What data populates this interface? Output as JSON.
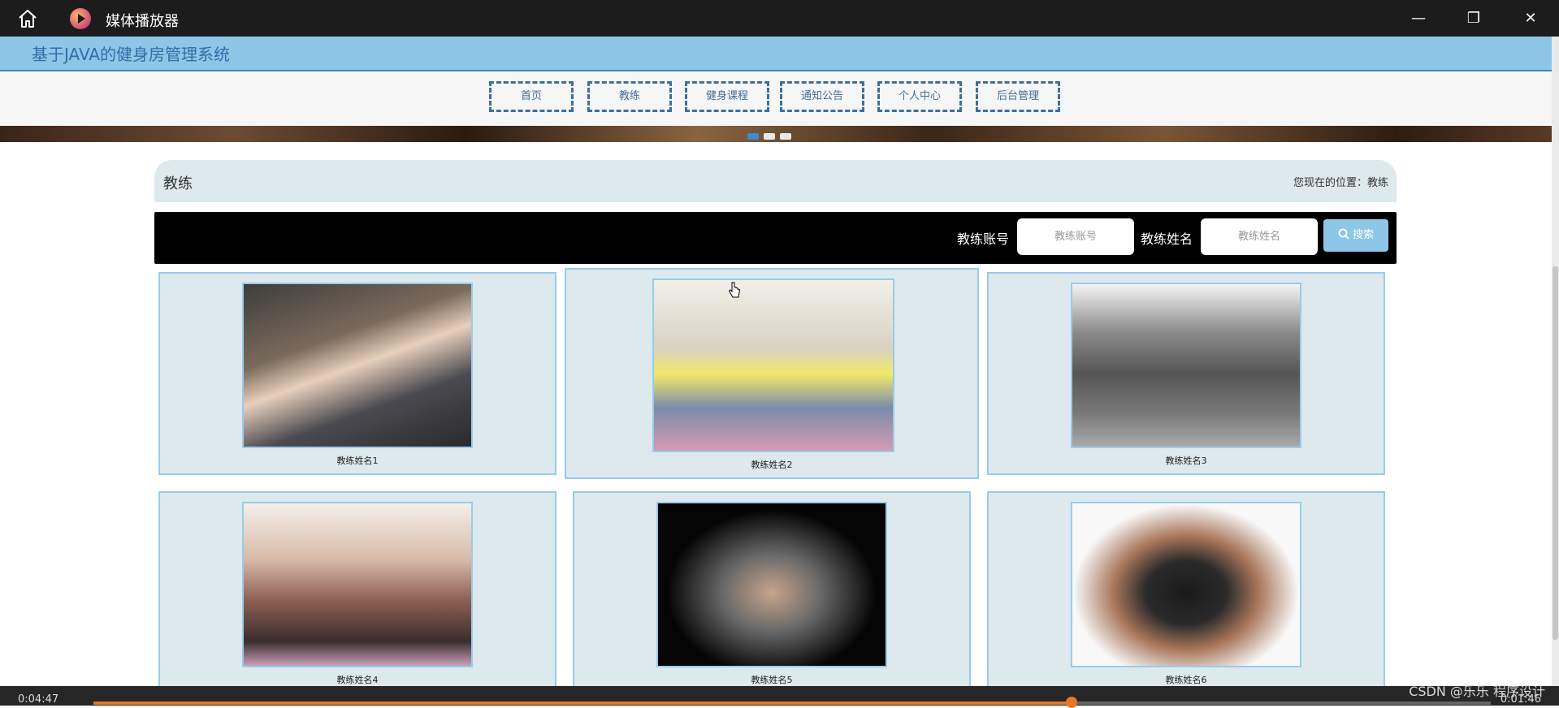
{
  "window": {
    "title": "媒体播放器",
    "home_icon": "home-icon",
    "app_icon": "media-player-icon",
    "minimize": "—",
    "restore": "❐",
    "close": "✕"
  },
  "site": {
    "title": "基于JAVA的健身房管理系统"
  },
  "nav": {
    "items": [
      "首页",
      "教练",
      "健身课程",
      "通知公告",
      "个人中心",
      "后台管理"
    ]
  },
  "breadcrumb": {
    "title": "教练",
    "location": "您现在的位置：教练"
  },
  "search": {
    "account_label": "教练账号",
    "account_placeholder": "教练账号",
    "name_label": "教练姓名",
    "name_placeholder": "教练姓名",
    "button_label": "搜索",
    "button_icon": "search-icon"
  },
  "coaches": [
    {
      "name": "教练姓名1"
    },
    {
      "name": "教练姓名2"
    },
    {
      "name": "教练姓名3"
    },
    {
      "name": "教练姓名4"
    },
    {
      "name": "教练姓名5"
    },
    {
      "name": "教练姓名6"
    }
  ],
  "player": {
    "current_time": "0:04:47",
    "remaining_time": "0:01:46",
    "progress_fraction": 0.7,
    "accent": "#e8762a"
  },
  "watermark": "CSDN @乐乐 程序设计"
}
